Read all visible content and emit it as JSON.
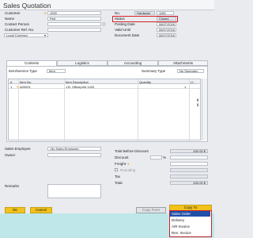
{
  "window": {
    "title": "Sales Quotation"
  },
  "header": {
    "left": [
      {
        "label": "Customer",
        "value": "1920",
        "arrow": true
      },
      {
        "label": "Name",
        "value": "Pelt"
      },
      {
        "label": "Contact Person",
        "value": ""
      },
      {
        "label": "Customer Ref. No.",
        "value": ""
      },
      {
        "label": "Local Currency",
        "value": ""
      }
    ],
    "right": [
      {
        "label": "No.",
        "series": "Hardware",
        "value": "1165"
      },
      {
        "label": "Status",
        "value": "Closed"
      },
      {
        "label": "Posting Date",
        "value": "06/07/2016"
      },
      {
        "label": "Valid Until",
        "value": "06/07/2016"
      },
      {
        "label": "Document Date",
        "value": "06/07/2016"
      }
    ]
  },
  "tabs": [
    "Contents",
    "Logistics",
    "Accounting",
    "Attachments"
  ],
  "contents": {
    "item_service_type_label": "Item/Service Type",
    "item_service_type_value": "Item",
    "summary_type_label": "Summary Type",
    "summary_type_value": "No Summary",
    "columns": [
      "#",
      "Item No.",
      "Item Description",
      "Quantity",
      "U..."
    ],
    "rows": [
      {
        "num": "1",
        "item_no": "A00001",
        "description": "J.B. Officeprint 1420",
        "quantity": "1"
      }
    ]
  },
  "footer": {
    "sales_employee_label": "Sales Employee",
    "sales_employee_value": "-No Sales Employee-",
    "owner_label": "Owner",
    "remarks_label": "Remarks",
    "totals": [
      {
        "label": "Total Before Discount",
        "value": "400.00 $"
      },
      {
        "label": "Discount",
        "value": "%"
      },
      {
        "label": "Freight",
        "value": ""
      },
      {
        "label": "Rounding",
        "value": ""
      },
      {
        "label": "Tax",
        "value": ""
      },
      {
        "label": "Total",
        "value": "400.00 $"
      }
    ]
  },
  "buttons": {
    "ok": "OK",
    "cancel": "Cancel",
    "copy_from": "Copy From",
    "copy_to": "Copy To"
  },
  "copy_to_menu": [
    "Sales Order",
    "Delivery",
    "A/R Invoice",
    "Res. Invoice"
  ],
  "colors": {
    "accent": "#f2c21a",
    "highlight": "#d3212b",
    "menu_selected": "#1f4fa8"
  }
}
